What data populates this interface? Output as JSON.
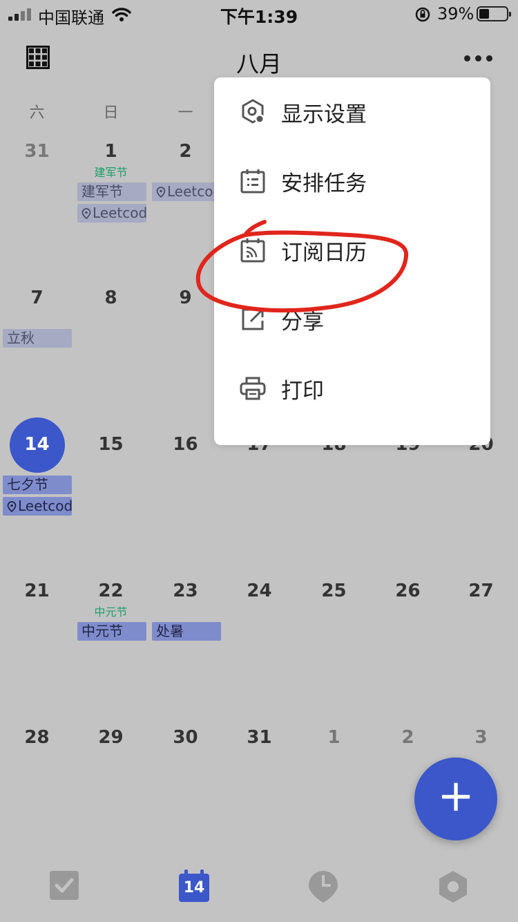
{
  "status_bar": {
    "carrier": "中国联通",
    "time": "下午1:39",
    "battery_percent": "39%"
  },
  "header": {
    "title": "八月"
  },
  "weekdays": [
    "六",
    "日",
    "一"
  ],
  "calendar": {
    "rows": [
      [
        "31",
        "1",
        "2"
      ],
      [
        "7",
        "8",
        "9"
      ],
      [
        "14",
        "15",
        "16",
        "17",
        "18",
        "19",
        "20"
      ],
      [
        "21",
        "22",
        "23",
        "24",
        "25",
        "26",
        "27"
      ],
      [
        "28",
        "29",
        "30",
        "31",
        "1",
        "2",
        "3"
      ]
    ],
    "today": "14",
    "holidays": {
      "jianjun": "建军节",
      "zhongyuan": "中元节"
    },
    "events": {
      "jianjun": "建军节",
      "leetcode": "Leetcod",
      "liqiu": "立秋",
      "qixi": "七夕节",
      "zhongyuan": "中元节",
      "chushu": "处暑"
    }
  },
  "menu": {
    "items": [
      {
        "label": "显示设置",
        "icon": "display-settings-icon"
      },
      {
        "label": "安排任务",
        "icon": "schedule-task-icon"
      },
      {
        "label": "订阅日历",
        "icon": "subscribe-calendar-icon"
      },
      {
        "label": "分享",
        "icon": "share-icon"
      },
      {
        "label": "打印",
        "icon": "print-icon"
      }
    ]
  },
  "fab": {
    "label": "+"
  },
  "bottom_nav": {
    "calendar_day": "14",
    "items": [
      "task-check-icon",
      "calendar-icon",
      "clock-icon",
      "settings-icon"
    ]
  },
  "colors": {
    "accent": "#3b57c9",
    "holiday_green": "#1b9f6a",
    "annotation_red": "#e0261c",
    "dim_background": "#c3c3c3"
  }
}
